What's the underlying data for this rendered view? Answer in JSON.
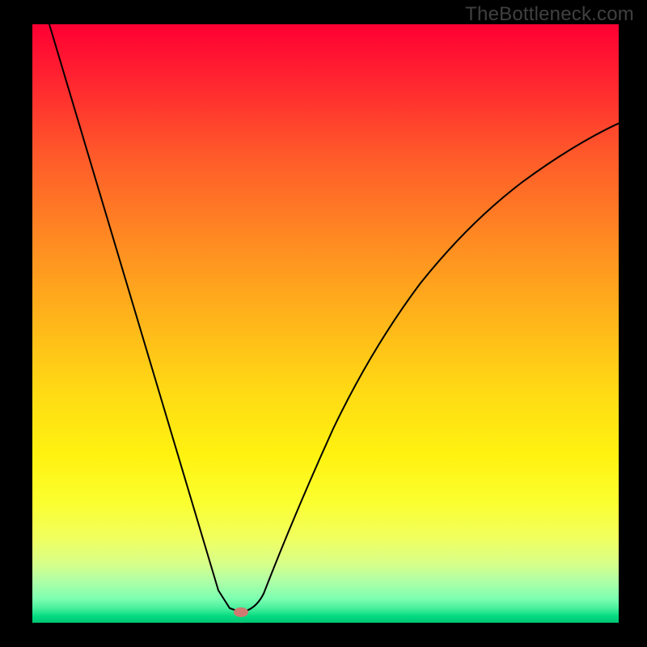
{
  "watermark": "TheBottleneck.com",
  "colors": {
    "curve": "#000000",
    "marker": "#cf7a70",
    "gradient_top": "#ff0033",
    "gradient_bottom": "#00c574"
  },
  "chart_data": {
    "type": "line",
    "title": "",
    "xlabel": "",
    "ylabel": "",
    "xlim": [
      0,
      100
    ],
    "ylim": [
      0,
      100
    ],
    "grid": false,
    "legend": false,
    "vertex_x": 35,
    "vertex_y": 2,
    "marker": {
      "x": 35,
      "y": 2,
      "color": "#cf7a70",
      "shape": "ellipse"
    },
    "background": {
      "type": "vertical-gradient",
      "stops": [
        {
          "pos": 0.0,
          "color": "#ff0033"
        },
        {
          "pos": 0.22,
          "color": "#ff5a2a"
        },
        {
          "pos": 0.5,
          "color": "#ffb71a"
        },
        {
          "pos": 0.72,
          "color": "#fff210"
        },
        {
          "pos": 0.9,
          "color": "#d8ff88"
        },
        {
          "pos": 1.0,
          "color": "#00c574"
        }
      ]
    },
    "series": [
      {
        "name": "left-branch",
        "x": [
          2,
          10,
          20,
          30,
          34,
          35
        ],
        "values": [
          100,
          78,
          49,
          20,
          5,
          2
        ]
      },
      {
        "name": "right-branch",
        "x": [
          35,
          38,
          45,
          55,
          65,
          75,
          85,
          95,
          100
        ],
        "values": [
          2,
          8,
          25,
          42,
          55,
          65,
          73,
          80,
          84
        ]
      }
    ]
  }
}
